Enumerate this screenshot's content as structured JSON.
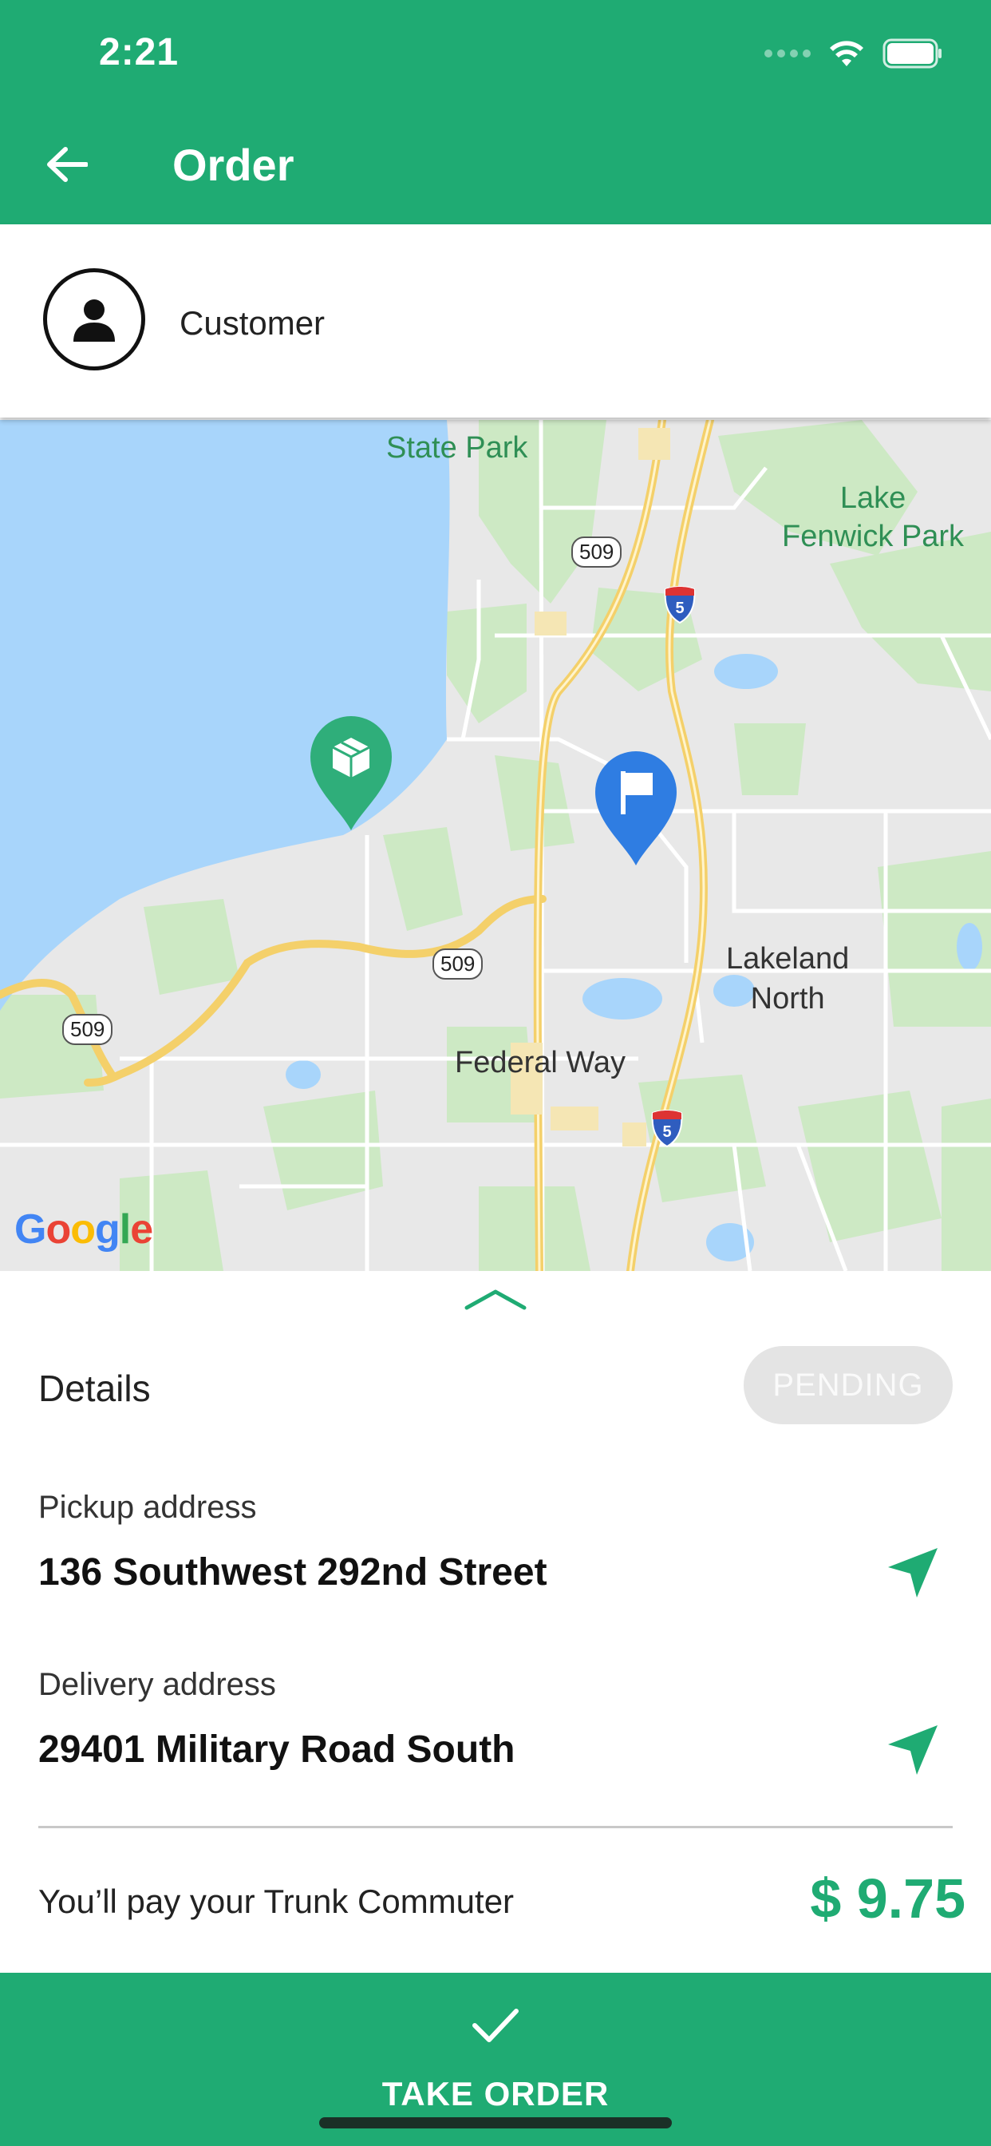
{
  "status_bar": {
    "time": "2:21"
  },
  "header": {
    "title": "Order"
  },
  "customer": {
    "name": "Customer"
  },
  "map": {
    "labels": {
      "state_park": "State Park",
      "lake_fenwick_park": "Lake Fenwick Park",
      "lake_fenwick_line1": "Lake",
      "lake_fenwick_line2": "Fenwick Park",
      "lakeland_north_line1": "Lakeland",
      "lakeland_north_line2": "North",
      "federal_way": "Federal Way",
      "route_509": "509",
      "interstate_5": "5"
    },
    "attribution": "Google"
  },
  "details": {
    "title": "Details",
    "status": "PENDING",
    "pickup_label": "Pickup address",
    "pickup_address": "136 Southwest 292nd Street",
    "delivery_label": "Delivery address",
    "delivery_address": "29401 Military Road South"
  },
  "payment": {
    "text": "You’ll pay your Trunk Commuter",
    "amount": "$ 9.75"
  },
  "action": {
    "label": "TAKE ORDER"
  },
  "colors": {
    "primary": "#1fab73",
    "pickup_marker": "#2fae7a",
    "delivery_marker": "#2f7de2",
    "water": "#a8d5fb"
  },
  "icons": [
    "back-arrow-icon",
    "person-icon",
    "package-icon",
    "flag-icon",
    "navigation-arrow-icon",
    "check-icon",
    "chevron-up-icon",
    "wifi-icon",
    "battery-icon"
  ]
}
